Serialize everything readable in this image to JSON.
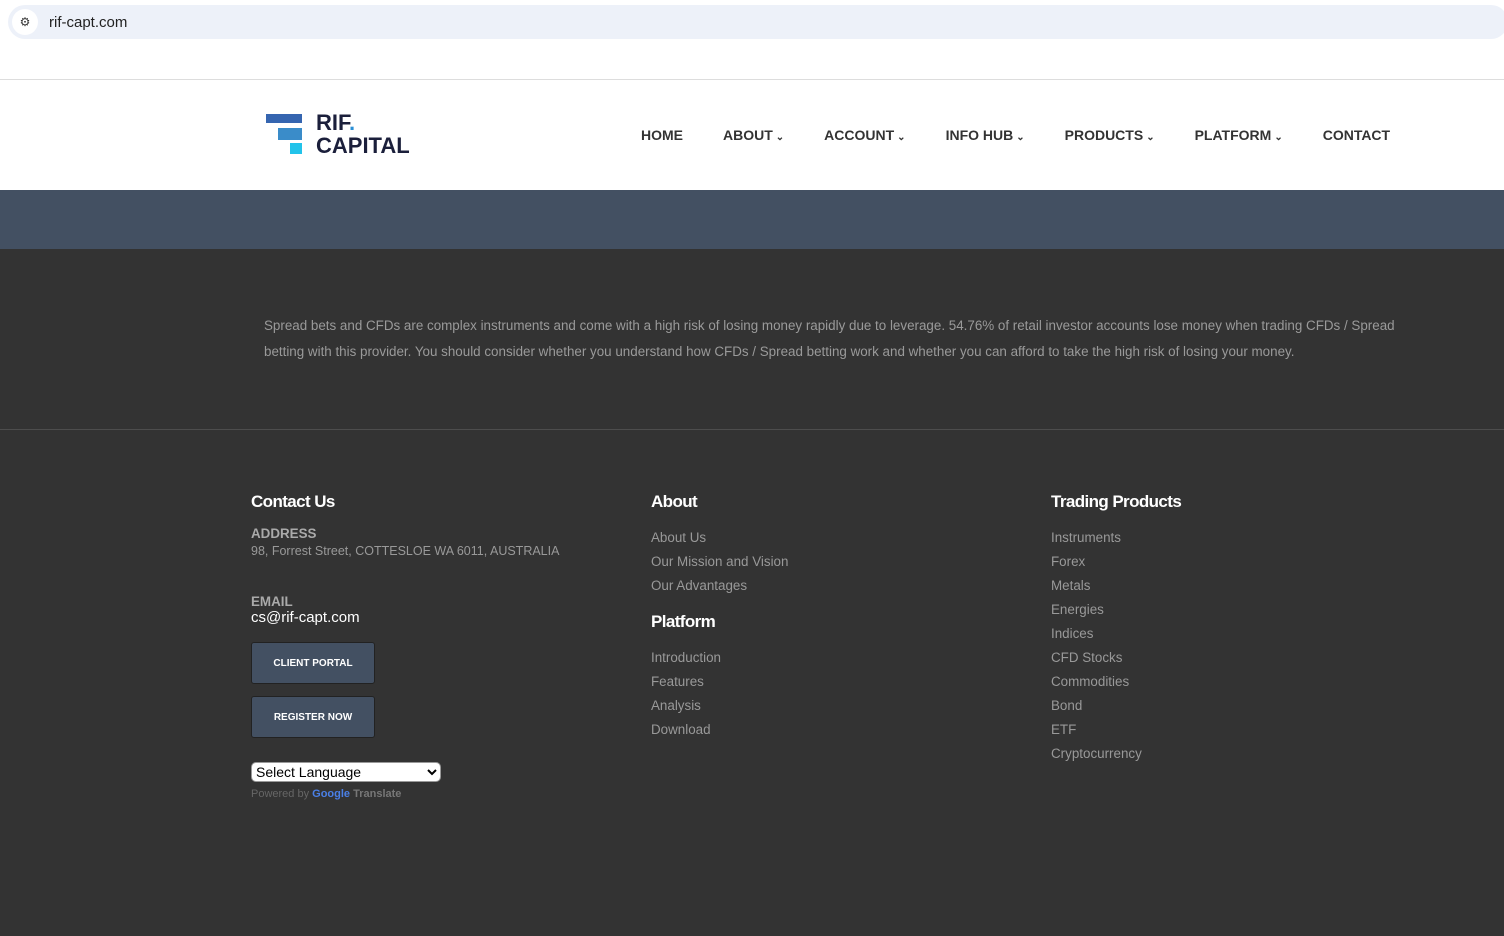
{
  "browser": {
    "url": "rif-capt.com"
  },
  "logo": {
    "line1": "RIF",
    "dot": ".",
    "line2": "CAPITAL"
  },
  "nav": [
    {
      "label": "HOME",
      "dropdown": false
    },
    {
      "label": "ABOUT",
      "dropdown": true
    },
    {
      "label": "ACCOUNT",
      "dropdown": true
    },
    {
      "label": "INFO HUB",
      "dropdown": true
    },
    {
      "label": "PRODUCTS",
      "dropdown": true
    },
    {
      "label": "PLATFORM",
      "dropdown": true
    },
    {
      "label": "CONTACT",
      "dropdown": false
    }
  ],
  "risk_warning": "Spread bets and CFDs are complex instruments and come with a high risk of losing money rapidly due to leverage. 54.76% of retail investor accounts lose money when trading CFDs / Spread betting with this provider. You should consider whether you understand how CFDs / Spread betting work and whether you can afford to take the high risk of losing your money.",
  "contact": {
    "title": "Contact Us",
    "address_label": "ADDRESS",
    "address": "98, Forrest Street, COTTESLOE WA 6011, AUSTRALIA",
    "email_label": "EMAIL",
    "email": "cs@rif-capt.com",
    "client_portal": "CLIENT PORTAL",
    "register": "REGISTER NOW",
    "language": "Select Language",
    "powered_by": "Powered by",
    "google": "Google",
    "translate": "Translate"
  },
  "about": {
    "title": "About",
    "links": [
      "About Us",
      "Our Mission and Vision",
      "Our Advantages"
    ]
  },
  "platform": {
    "title": "Platform",
    "links": [
      "Introduction",
      "Features",
      "Analysis",
      "Download"
    ]
  },
  "products": {
    "title": "Trading Products",
    "links": [
      "Instruments",
      "Forex",
      "Metals",
      "Energies",
      "Indices",
      "CFD Stocks",
      "Commodities",
      "Bond",
      "ETF",
      "Cryptocurrency"
    ]
  }
}
